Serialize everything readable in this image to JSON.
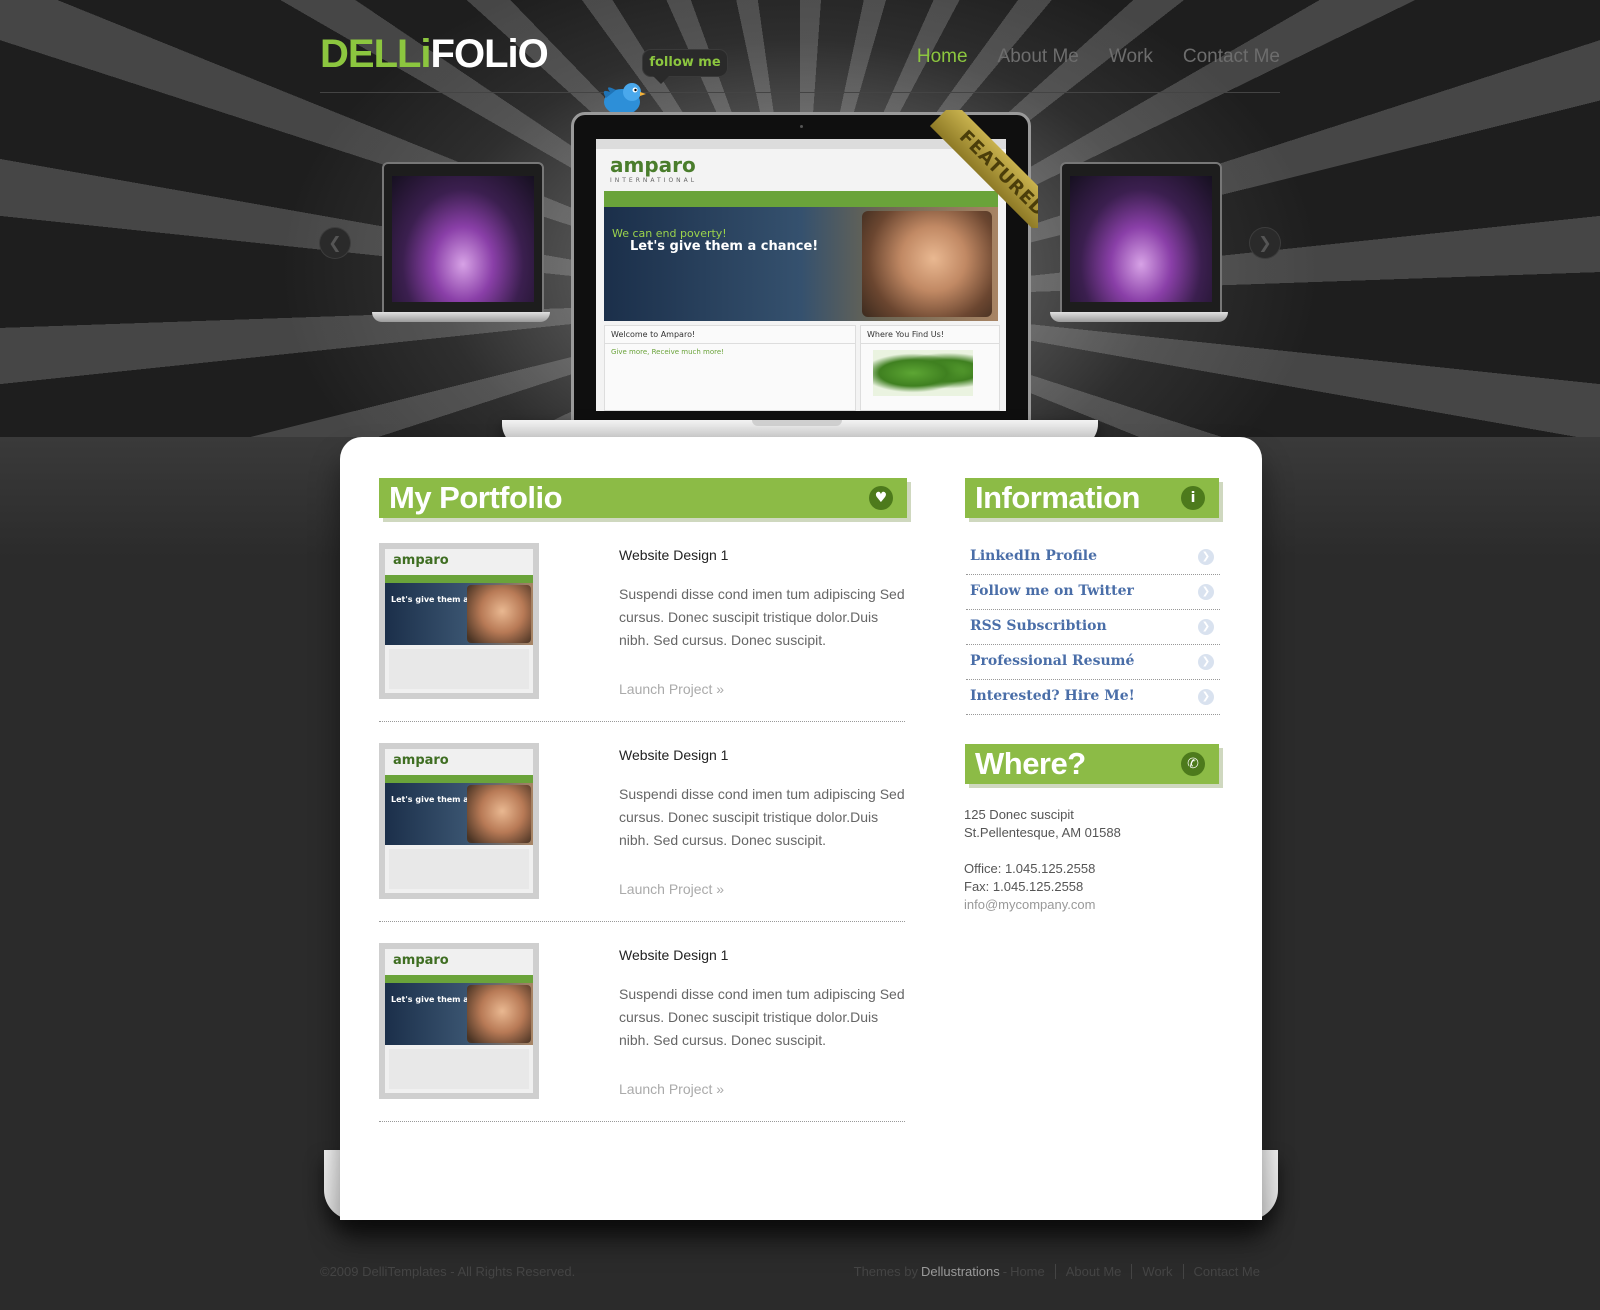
{
  "brand": {
    "logo_part1": "DELLi",
    "logo_part2": "FOLiO",
    "accent": "#8cc63f"
  },
  "nav": [
    "Home",
    "About Me",
    "Work",
    "Contact Me"
  ],
  "follow_label": "follow me",
  "featured_label": "FEATURED",
  "showcase": {
    "site_name": "amparo",
    "site_sub": "INTERNATIONAL",
    "tagline1": "We can end poverty!",
    "tagline2": "Let's give them a chance!",
    "welcome": "Welcome to Amparo!",
    "give_more": "Give more, Receive much more!",
    "where": "Where You Find Us!"
  },
  "portfolio": {
    "heading": "My Portfolio",
    "items": [
      {
        "name": "Website Design 1",
        "desc": "Suspendi disse cond imen tum adipiscing Sed cursus. Donec suscipit tristique dolor.Duis nibh. Sed cursus. Donec suscipit.",
        "link": "Launch Project »",
        "thumb_logo": "amparo",
        "thumb_tag": "Let's give them a chance!"
      },
      {
        "name": "Website Design 1",
        "desc": "Suspendi disse cond imen tum adipiscing Sed cursus. Donec suscipit tristique dolor.Duis nibh. Sed cursus. Donec suscipit.",
        "link": "Launch Project »",
        "thumb_logo": "amparo",
        "thumb_tag": "Let's give them a chance!"
      },
      {
        "name": "Website Design 1",
        "desc": "Suspendi disse cond imen tum adipiscing Sed cursus. Donec suscipit tristique dolor.Duis nibh. Sed cursus. Donec suscipit.",
        "link": "Launch Project »",
        "thumb_logo": "amparo",
        "thumb_tag": "Let's give them a chance!"
      }
    ]
  },
  "information": {
    "heading": "Information",
    "links": [
      "LinkedIn Profile",
      "Follow me on Twitter",
      "RSS Subscribtion",
      "Professional Resumé",
      "Interested? Hire Me!"
    ]
  },
  "where": {
    "heading": "Where?",
    "address1": "125 Donec suscipit",
    "address2": "St.Pellentesque, AM 01588",
    "office": "Office: 1.045.125.2558",
    "fax": "Fax: 1.045.125.2558",
    "email": "info@mycompany.com"
  },
  "footer": {
    "copyright": "©2009 DelliTemplates - All Rights Reserved.",
    "themes_by": "Themes by",
    "brand": "Dellustrations",
    "dash": "-",
    "links": [
      "Home",
      "About Me",
      "Work",
      "Contact Me"
    ]
  }
}
